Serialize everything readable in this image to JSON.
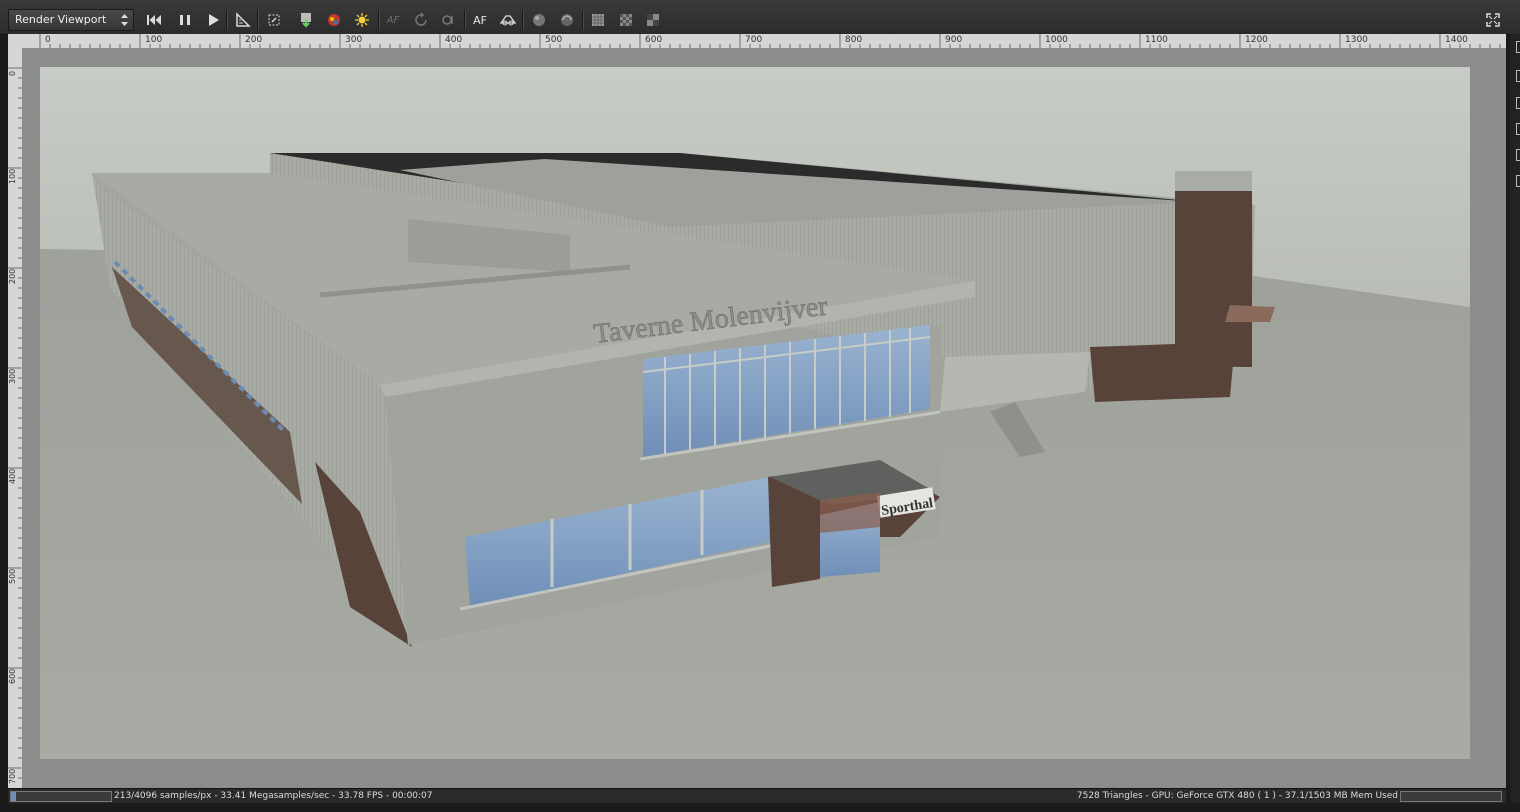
{
  "toolbar": {
    "viewport_select_value": "Render Viewport",
    "buttons": {
      "restart": "⏮",
      "pause": "⏸",
      "play": "▶",
      "af_dim": "AF",
      "af_active": "AF"
    }
  },
  "ruler": {
    "h_labels": [
      "0",
      "100",
      "200",
      "300",
      "400",
      "500",
      "600",
      "700",
      "800",
      "900",
      "1000",
      "1100",
      "1200",
      "1300",
      "1400"
    ],
    "v_labels": [
      "0",
      "100",
      "200",
      "300",
      "400",
      "500",
      "600",
      "700"
    ]
  },
  "scene": {
    "sign_main": "Taverne Molenvijver",
    "sign_small": "Sporthal"
  },
  "status": {
    "left": "213/4096 samples/px - 33.41 Megasamples/sec - 33.78 FPS - 00:00:07",
    "right": "7528 Triangles - GPU: GeForce GTX 480  ( 1 )  - 37.1/1503 MB Mem Used",
    "progress": 0.052
  },
  "icons": [
    "restart-icon",
    "pause-icon",
    "play-icon",
    "measure-icon",
    "region-icon",
    "save-render-icon",
    "color-picker-icon",
    "sun-icon",
    "af-icon",
    "refresh-icon",
    "focus-icon",
    "camera-icon",
    "sphere-icon",
    "sphere-refresh-icon",
    "grid-icon",
    "checker-icon",
    "half-checker-icon",
    "fullscreen-icon"
  ]
}
